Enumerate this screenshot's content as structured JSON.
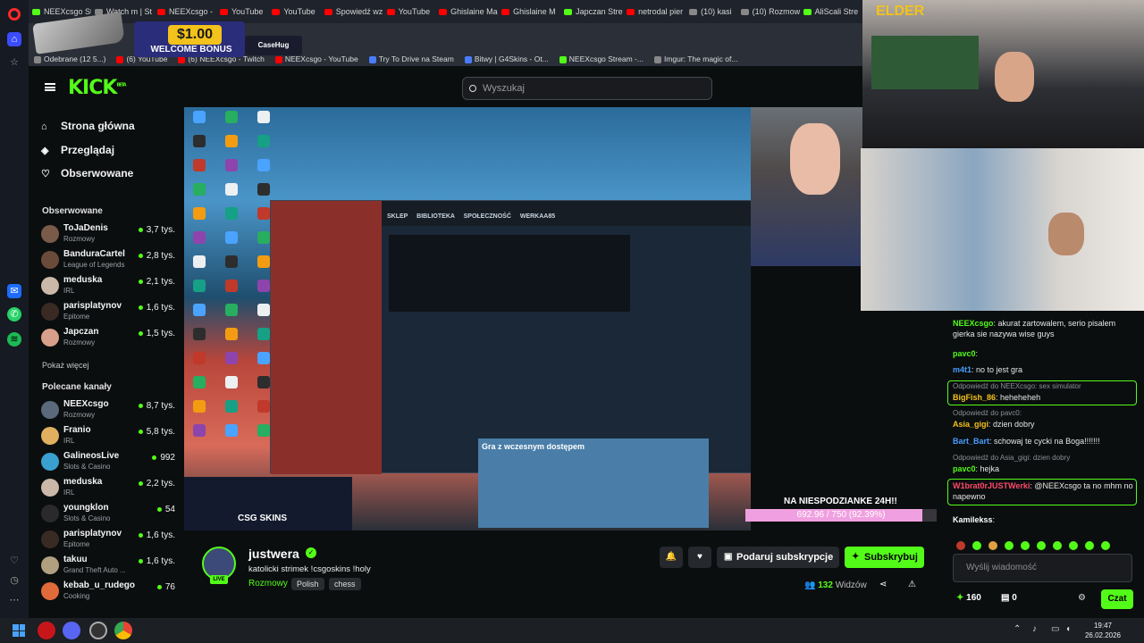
{
  "browser": {
    "tabs": [
      {
        "label": "NEEXcsgo St",
        "fav": "kick"
      },
      {
        "label": "Watch m | St",
        "fav": "gray"
      },
      {
        "label": "NEEXcsgo -",
        "fav": "youtube"
      },
      {
        "label": "YouTube",
        "fav": "youtube"
      },
      {
        "label": "YouTube",
        "fav": "youtube"
      },
      {
        "label": "Spowiedź wz",
        "fav": "youtube"
      },
      {
        "label": "YouTube",
        "fav": "youtube"
      },
      {
        "label": "Ghislaine Ma",
        "fav": "youtube"
      },
      {
        "label": "Ghislaine M",
        "fav": "youtube"
      },
      {
        "label": "Japczan Stre",
        "fav": "kick"
      },
      {
        "label": "netrodal pier",
        "fav": "youtube"
      },
      {
        "label": "(10) kasi",
        "fav": "gray"
      },
      {
        "label": "(10) Rozmow",
        "fav": "gray"
      },
      {
        "label": "AliScali Stre",
        "fav": "kick"
      }
    ],
    "bookmarks": [
      {
        "label": "Odebrane (12 5...)",
        "fav": "gray"
      },
      {
        "label": "(6) YouTube",
        "fav": "youtube"
      },
      {
        "label": "(6) NEEXcsgo - Twitch",
        "fav": "youtube"
      },
      {
        "label": "NEEXcsgo - YouTube",
        "fav": "youtube"
      },
      {
        "label": "Try To Drive na Steam",
        "fav": "blue"
      },
      {
        "label": "Bitwy | G4Skins - Ot...",
        "fav": "blue"
      },
      {
        "label": "NEEXcsgo Stream -...",
        "fav": "kick"
      },
      {
        "label": "Imgur: The magic of...",
        "fav": "gray"
      }
    ]
  },
  "ad": {
    "price": "$1.00",
    "bonus": "WELCOME BONUS",
    "brand": "CaseHug"
  },
  "kick": {
    "logo": "KICK",
    "logo_sup": "BETA",
    "search_placeholder": "Wyszukaj",
    "accent": "#53fc18"
  },
  "sidebar": {
    "nav": [
      {
        "label": "Strona główna",
        "icon": "home-icon"
      },
      {
        "label": "Przeglądaj",
        "icon": "compass-icon"
      },
      {
        "label": "Obserwowane",
        "icon": "heart-icon"
      }
    ],
    "followed_title": "Obserwowane",
    "followed": [
      {
        "name": "ToJaDenis",
        "category": "Rozmowy",
        "viewers": "3,7 tys.",
        "color": "#7a5b4a"
      },
      {
        "name": "BanduraCartel",
        "category": "League of Legends",
        "viewers": "2,8 tys.",
        "color": "#6a4b3a"
      },
      {
        "name": "meduska",
        "category": "IRL",
        "viewers": "2,1 tys.",
        "color": "#cbb8a8"
      },
      {
        "name": "parisplatynov",
        "category": "Epitome",
        "viewers": "1,6 tys.",
        "color": "#3a2a24"
      },
      {
        "name": "Japczan",
        "category": "Rozmowy",
        "viewers": "1,5 tys.",
        "color": "#d8a08a"
      }
    ],
    "show_more": "Pokaż więcej",
    "recommended_title": "Polecane kanały",
    "recommended": [
      {
        "name": "NEEXcsgo",
        "category": "Rozmowy",
        "viewers": "8,7 tys.",
        "color": "#5a6a7a"
      },
      {
        "name": "Franio",
        "category": "IRL",
        "viewers": "5,8 tys.",
        "color": "#e0b060"
      },
      {
        "name": "GalineosLive",
        "category": "Slots & Casino",
        "viewers": "992",
        "color": "#3aa0d0"
      },
      {
        "name": "meduska",
        "category": "IRL",
        "viewers": "2,2 tys.",
        "color": "#cbb8a8"
      },
      {
        "name": "youngklon",
        "category": "Slots & Casino",
        "viewers": "54",
        "color": "#2a2a2a"
      },
      {
        "name": "parisplatynov",
        "category": "Epitome",
        "viewers": "1,6 tys.",
        "color": "#3a2a24"
      },
      {
        "name": "takuu",
        "category": "Grand Theft Auto ...",
        "viewers": "1,6 tys.",
        "color": "#b0a080"
      },
      {
        "name": "kebab_u_rudego",
        "category": "Cooking",
        "viewers": "76",
        "color": "#e06a3a"
      }
    ]
  },
  "player": {
    "goal_label": "NA NIESPODZIANKE 24H!!",
    "goal_text": "692.96 / 750 (92.39%)",
    "goal_fraction": 0.9239,
    "overlay_brand": "CSG SKINS",
    "steam_nav": "SKLEP BIBLIOTEKA SPOŁECZNOŚĆ WERKAA85",
    "early_access_title": "Gra z wczesnym dostępem"
  },
  "stream": {
    "streamer": "justwera",
    "live_badge": "LIVE",
    "title": "katolicki strimek !csgoskins !holy",
    "category": "Rozmowy",
    "tags": [
      "Polish",
      "chess"
    ],
    "gift_label": "Podaruj subskrypcje",
    "subscribe_label": "Subskrybuj",
    "viewers_count": "132",
    "viewers_label": "Widzów"
  },
  "chat": {
    "messages": [
      {
        "user": "NEEXcsgo",
        "color": "#53fc18",
        "text": "akurat zartowalem, serio pisalem gierka sie nazywa wise guys"
      },
      {
        "user": "pavc0",
        "color": "#53fc18",
        "text": ""
      },
      {
        "user": "m4t1",
        "color": "#4a9dff",
        "text": "no to jest gra"
      },
      {
        "reply": "Odpowiedź do NEEXcsgo: sex simulator",
        "user": "BigFish_86",
        "color": "#f3c21b",
        "text": "heheheheh",
        "highlight": true
      },
      {
        "reply": "Odpowiedź do pavc0:",
        "user": "Asia_gigi",
        "color": "#f3c21b",
        "text": "dzien dobry"
      },
      {
        "user": "Bart_Bart",
        "color": "#4a9dff",
        "text": "schowaj te cycki na Boga!!!!!!!"
      },
      {
        "reply": "Odpowiedź do Asia_gigi: dzien dobry",
        "user": "pavc0",
        "color": "#53fc18",
        "text": "hejka"
      },
      {
        "user": "W1brat0rJUSTWerki",
        "color": "#ff4a6a",
        "text": "@NEEXcsgo ta no mhm no napewno",
        "highlight": true
      },
      {
        "user": "Kamilekss",
        "color": "#ffffff",
        "text": ""
      }
    ],
    "input_placeholder": "Wyślij wiadomość",
    "points": "160",
    "store_count": "0",
    "chat_button": "Czat"
  },
  "taskbar": {
    "time": "19:47",
    "date": "26.02.2026"
  },
  "webcam": {
    "overlay_text": "ELDER"
  }
}
